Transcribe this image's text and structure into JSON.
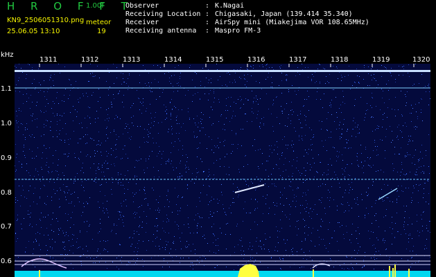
{
  "header": {
    "title": "H R O F F T",
    "version": "1.00f",
    "filename": "KN9_2506051310.png",
    "mode": "meteor",
    "datetime": "25.06.05 13:10",
    "count": "19"
  },
  "info": {
    "observer_key": "Observer",
    "observer_val": "K.Nagai",
    "location_key": "Receiving Location",
    "location_val": "Chigasaki, Japan (139.414 35.340)",
    "receiver_key": "Receiver",
    "receiver_val": "AirSpy mini (Miakejima VOR 108.65MHz)",
    "antenna_key": "Receiving antenna",
    "antenna_val": "Maspro FM-3"
  },
  "axis": {
    "unit": "kHz",
    "yticks": [
      "1.1",
      "1.0",
      "0.9",
      "0.8",
      "0.7",
      "0.6"
    ],
    "xticks": [
      "1311",
      "1312",
      "1313",
      "1314",
      "1315",
      "1316",
      "1317",
      "1318",
      "1319",
      "1320"
    ]
  },
  "colors": {
    "background": "#040a3c",
    "noise": "#3a6cff",
    "carrier": "#c8e0ff",
    "floor": "#00d8f0",
    "burst": "#ffff40"
  }
}
